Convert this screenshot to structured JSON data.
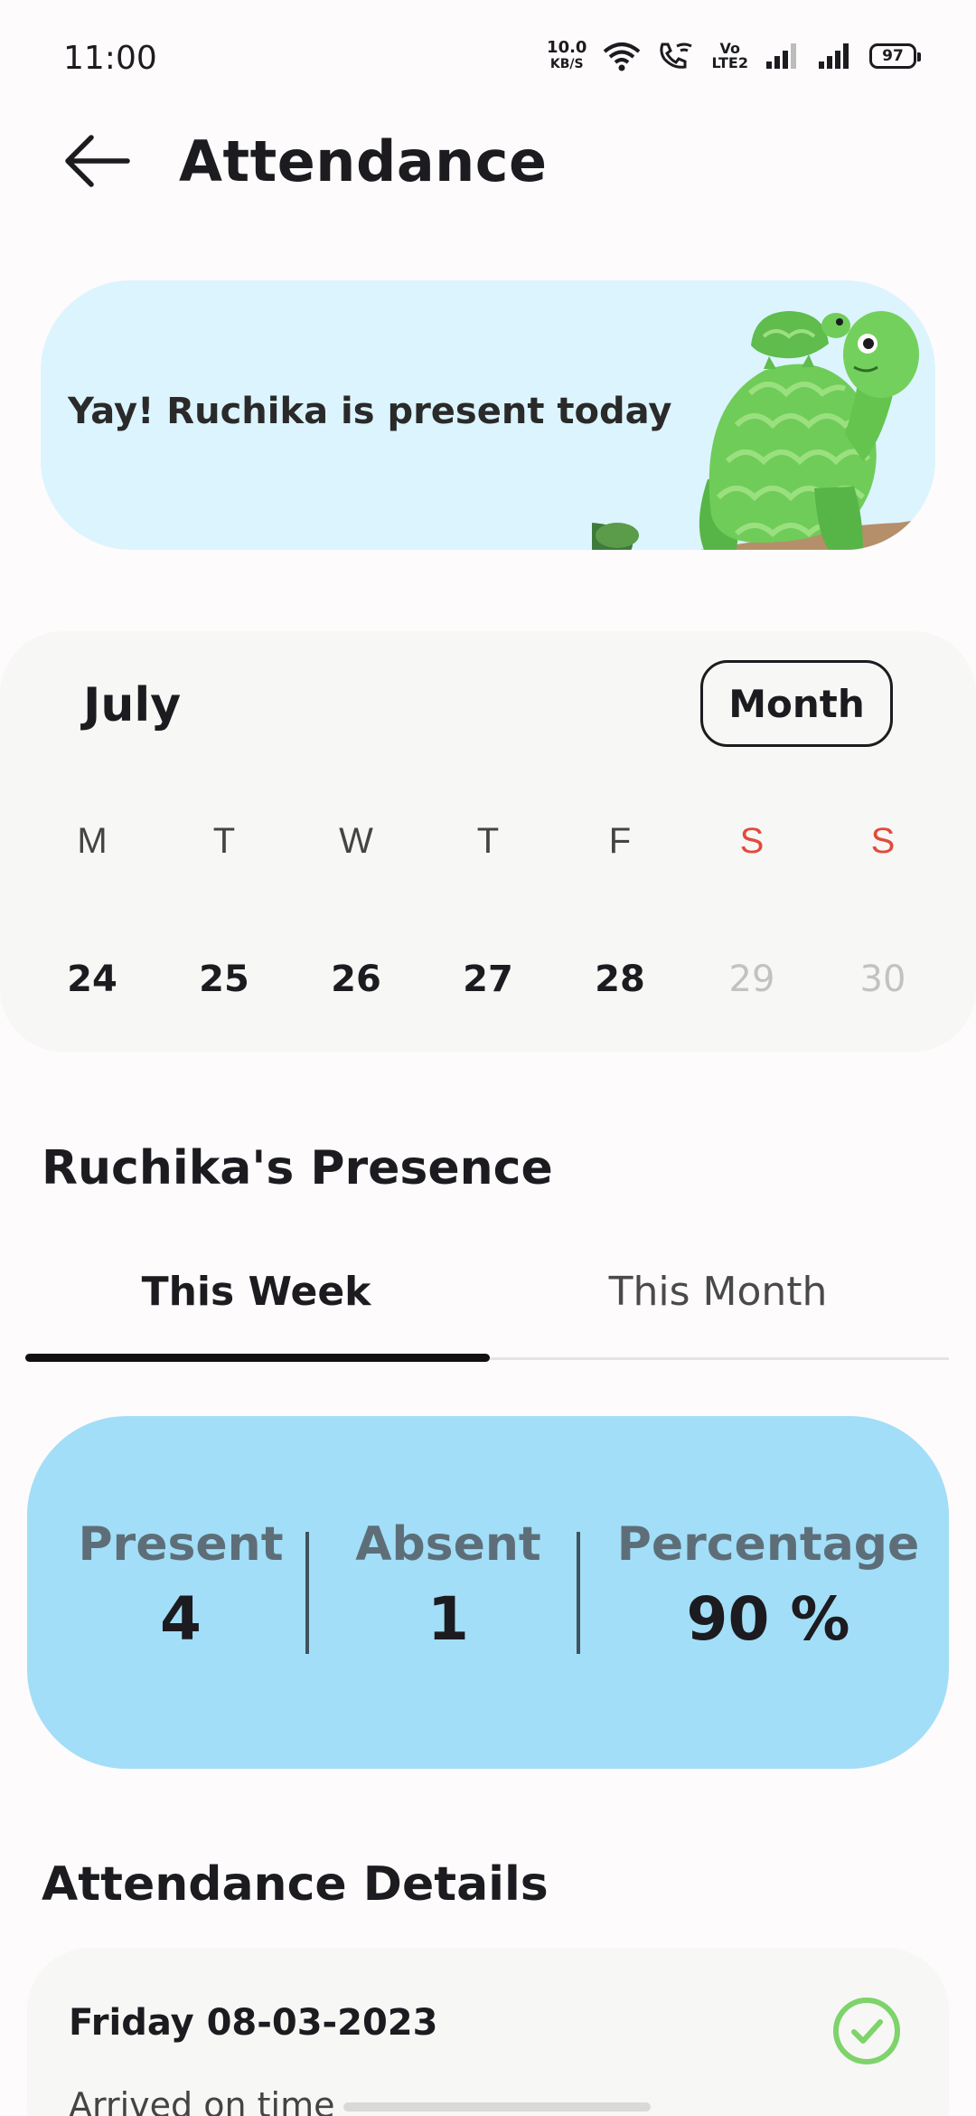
{
  "status_bar": {
    "time": "11:00",
    "net_speed_value": "10.0",
    "net_speed_unit": "KB/S",
    "volte_top": "Vo",
    "volte_bottom": "LTE2",
    "battery": "97"
  },
  "app_bar": {
    "title": "Attendance",
    "back_icon": "arrow-left-icon"
  },
  "banner": {
    "message": "Yay! Ruchika is present today",
    "illustration": "turtle-illustration"
  },
  "calendar": {
    "month": "July",
    "view_button": "Month",
    "weekdays": [
      "M",
      "T",
      "W",
      "T",
      "F",
      "S",
      "S"
    ],
    "dates": [
      "24",
      "25",
      "26",
      "27",
      "28",
      "29",
      "30"
    ],
    "weekend_color": "#e24a3b"
  },
  "presence": {
    "title": "Ruchika's Presence",
    "tabs": [
      "This Week",
      "This Month"
    ],
    "active_tab": "This Week",
    "stats": {
      "present_label": "Present",
      "present_value": "4",
      "absent_label": "Absent",
      "absent_value": "1",
      "percentage_label": "Percentage",
      "percentage_value": "90 %"
    },
    "stats_color": "#a2def7"
  },
  "details": {
    "title": "Attendance Details",
    "items": [
      {
        "date": "Friday 08-03-2023",
        "status": "Arrived on time",
        "icon": "check-circle-icon"
      }
    ],
    "check_color": "#7ed36a"
  }
}
